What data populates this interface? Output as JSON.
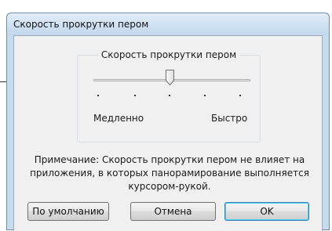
{
  "window": {
    "title": "Скорость прокрутки пером"
  },
  "group": {
    "title": "Скорость прокрутки пером",
    "slider": {
      "tick_count": 5,
      "selected_tick_index": 2,
      "min_label": "Медленно",
      "max_label": "Быстро"
    }
  },
  "note": {
    "lines": [
      "Примечание: Скорость прокрутки пером не влияет на",
      "приложения, в которых панорамирование выполняется",
      "курсором-рукой."
    ]
  },
  "buttons": {
    "defaults": "По умолчанию",
    "cancel": "Отмена",
    "ok": "OK"
  },
  "colors": {
    "titlebar": "#d2e3f3",
    "client": "#f0f0f0",
    "ok_border": "#3c7fb1"
  }
}
